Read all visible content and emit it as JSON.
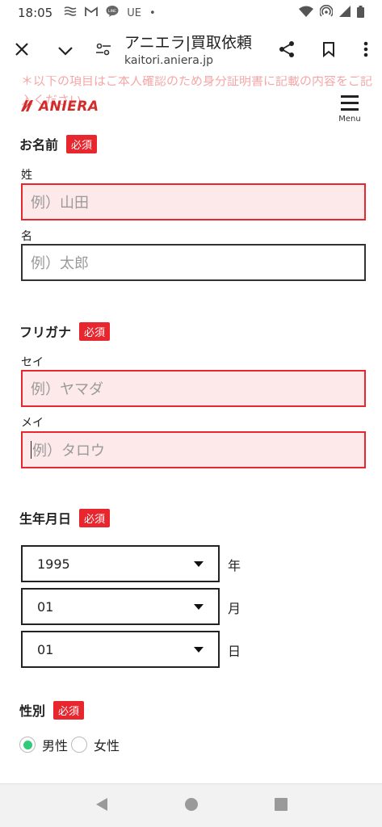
{
  "status_bar": {
    "time": "18:05",
    "carrier_text": "UE",
    "dot": "•",
    "icons": [
      "stacked-lines-icon",
      "gmail-icon",
      "line-icon",
      "wifi-icon",
      "hotspot-icon",
      "signal-icon",
      "battery-icon"
    ]
  },
  "toolbar": {
    "title": "アニエラ|買取依頼",
    "url": "kaitori.aniera.jp"
  },
  "page": {
    "faded_note": "＊以下の項目はご本人確認のため身分証明書に記載の内容をご記入ください。",
    "logo_text": "ANIERA",
    "menu_label": "Menu",
    "required_badge": "必須",
    "name_section": {
      "title": "お名前",
      "last_label": "姓",
      "last_placeholder": "例）山田",
      "first_label": "名",
      "first_placeholder": "例）太郎"
    },
    "furigana_section": {
      "title": "フリガナ",
      "sei_label": "セイ",
      "sei_placeholder": "例）ヤマダ",
      "mei_label": "メイ",
      "mei_placeholder": "例）タロウ"
    },
    "birth_section": {
      "title": "生年月日",
      "year_value": "1995",
      "year_unit": "年",
      "month_value": "01",
      "month_unit": "月",
      "day_value": "01",
      "day_unit": "日"
    },
    "gender_section": {
      "title": "性別",
      "options": [
        "男性",
        "女性"
      ],
      "selected": "男性"
    }
  },
  "colors": {
    "accent_red": "#e8262d",
    "error_bg": "#fde9e9",
    "radio_selected": "#2fcb78"
  }
}
